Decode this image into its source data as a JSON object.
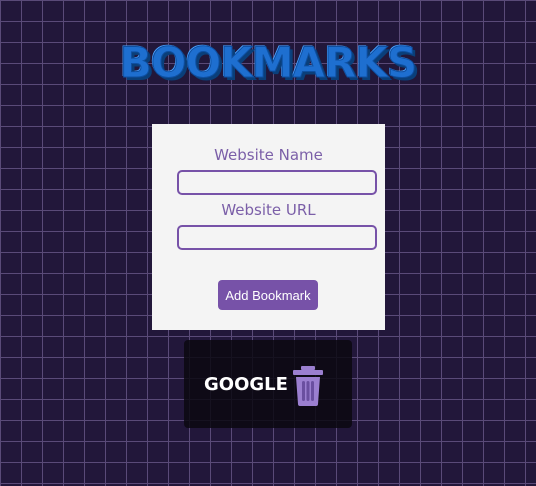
{
  "header": {
    "title": "BOOKMARKS"
  },
  "form": {
    "name_label": "Website Name",
    "name_value": "",
    "url_label": "Website URL",
    "url_value": "",
    "submit_label": "Add Bookmark"
  },
  "bookmarks": [
    {
      "name": "GOOGLE",
      "delete_icon": "trash-icon"
    }
  ],
  "colors": {
    "accent": "#7752a8",
    "title": "#1e6fd0",
    "background": "#22173a",
    "card": "#f4f4f4"
  }
}
